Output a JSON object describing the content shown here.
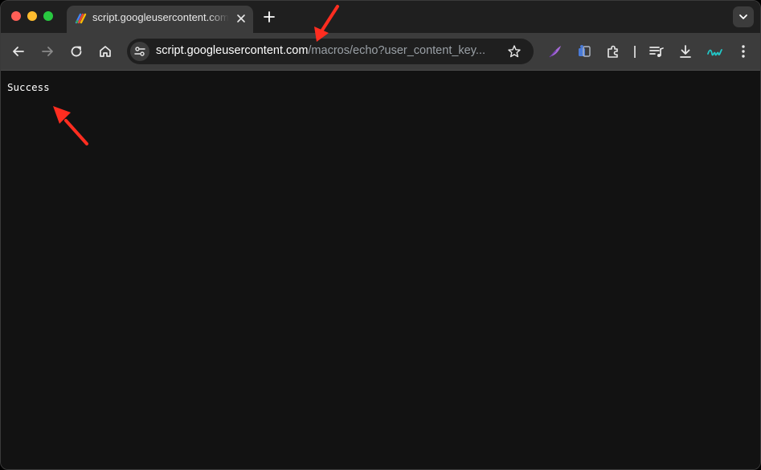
{
  "tab": {
    "title": "script.googleusercontent.com"
  },
  "omnibox": {
    "host": "script.googleusercontent.com",
    "path": "/macros/echo?user_content_key..."
  },
  "page": {
    "message": "Success"
  },
  "colors": {
    "accent_arrow": "#ff2d20",
    "page_bg": "#121212",
    "toolbar_bg": "#3c3c3c"
  },
  "icons": {
    "extensions": [
      "quill-extension-icon",
      "translate-extension-icon",
      "puzzle-extensions-icon",
      "media-queue-icon",
      "download-icon",
      "wave-extension-icon",
      "kebab-menu-icon"
    ]
  }
}
